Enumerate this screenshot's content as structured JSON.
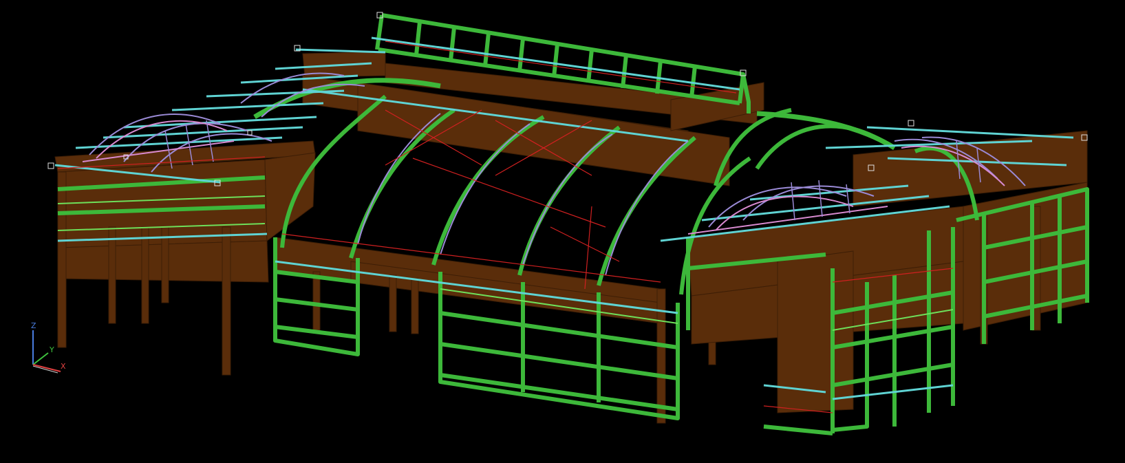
{
  "viewport": {
    "background": "#000000",
    "palette": {
      "timber": "#5a2d0a",
      "timber_edge": "#3d1e06",
      "timber_light": "#6b3810",
      "steel_green": "#3db83a",
      "steel_green_light": "#6ee05a",
      "purlin_cyan": "#5fd3d3",
      "truss_violet": "#9a8ad6",
      "truss_pink": "#d88ad0",
      "bracing_red": "#d02020",
      "node_white": "#e0e0e0"
    }
  },
  "ucs": {
    "z_label": "Z",
    "y_label": "Y",
    "x_label": "X",
    "colors": {
      "z": "#4a7de0",
      "y": "#3ec23e",
      "x": "#e04040"
    }
  }
}
